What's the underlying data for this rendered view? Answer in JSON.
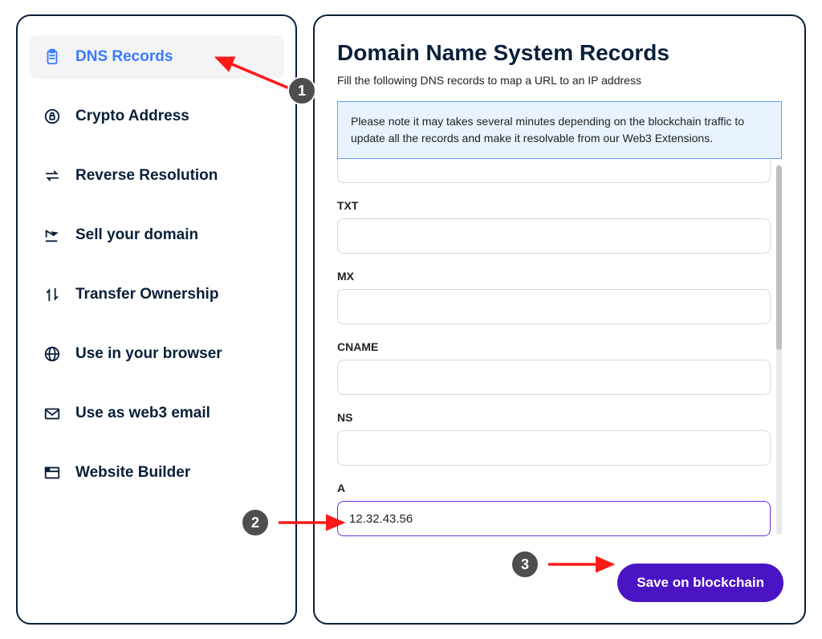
{
  "sidebar": {
    "items": [
      {
        "label": "DNS Records",
        "icon": "clipboard-icon",
        "active": true
      },
      {
        "label": "Crypto Address",
        "icon": "lock-circle-icon",
        "active": false
      },
      {
        "label": "Reverse Resolution",
        "icon": "swap-icon",
        "active": false
      },
      {
        "label": "Sell your domain",
        "icon": "share-icon",
        "active": false
      },
      {
        "label": "Transfer Ownership",
        "icon": "updown-icon",
        "active": false
      },
      {
        "label": "Use in your browser",
        "icon": "globe-icon",
        "active": false
      },
      {
        "label": "Use as web3 email",
        "icon": "mail-icon",
        "active": false
      },
      {
        "label": "Website Builder",
        "icon": "layout-icon",
        "active": false
      }
    ]
  },
  "main": {
    "title": "Domain Name System Records",
    "subtitle": "Fill the following DNS records to map a URL to an IP address",
    "notice": "Please note it may takes several minutes depending on the blockchain traffic to update all the records and make it resolvable from our Web3 Extensions.",
    "fields": {
      "txt": {
        "label": "TXT",
        "value": ""
      },
      "mx": {
        "label": "MX",
        "value": ""
      },
      "cname": {
        "label": "CNAME",
        "value": ""
      },
      "ns": {
        "label": "NS",
        "value": ""
      },
      "a": {
        "label": "A",
        "value": "12.32.43.56"
      }
    },
    "save_label": "Save on blockchain"
  },
  "annotations": {
    "step1": "1",
    "step2": "2",
    "step3": "3"
  },
  "colors": {
    "accent_blue": "#3a7bff",
    "notice_bg": "#e9f3ff",
    "notice_border": "#5aa0ff",
    "button_purple": "#4a13c4",
    "focus_purple": "#6b2fe0",
    "anno_red": "#ff1a1a",
    "anno_grey": "#4e4e4e"
  }
}
